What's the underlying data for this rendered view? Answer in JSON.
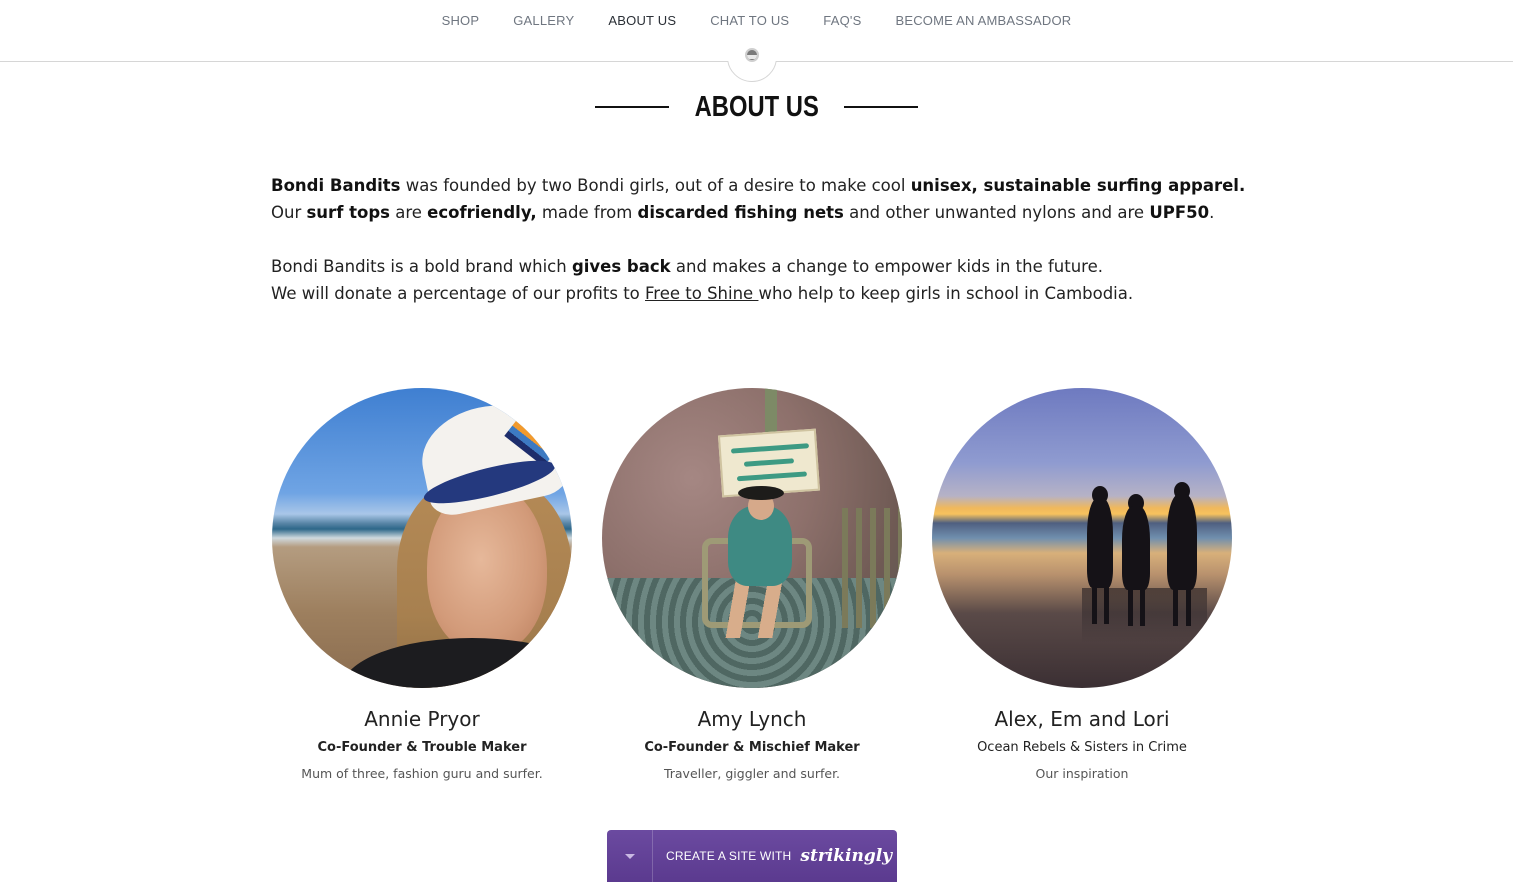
{
  "nav": {
    "items": [
      {
        "label": "SHOP"
      },
      {
        "label": "GALLERY"
      },
      {
        "label": "ABOUT US"
      },
      {
        "label": "CHAT TO US"
      },
      {
        "label": "FAQ'S"
      },
      {
        "label": "BECOME AN AMBASSADOR"
      }
    ],
    "active_index": 2
  },
  "section": {
    "title": "ABOUT US"
  },
  "intro": {
    "p1": {
      "brand": "Bondi Bandits",
      "t1": " was founded by two Bondi girls, out of a desire to make cool ",
      "b1": "unisex, sustainable surfing apparel.",
      "t2": "Our ",
      "b2": "surf tops",
      "t3": " are ",
      "b3": "ecofriendly,",
      "t4": " made from ",
      "b4": "discarded fishing nets",
      "t5": " and other unwanted nylons and are ",
      "b5": "UPF50",
      "t6": "."
    },
    "p2": {
      "t1": "Bondi Bandits is a bold brand which ",
      "b1": "gives back",
      "t2": " and makes a change to empower kids in the future.",
      "t3": "We will donate a percentage of our profits to ",
      "link": "Free to Shine ",
      "t4": "who help to keep girls in school in Cambodia."
    }
  },
  "team": [
    {
      "name": "Annie Pryor",
      "role": "Co-Founder & Trouble Maker",
      "desc": "Mum of three, fashion guru and surfer."
    },
    {
      "name": "Amy Lynch",
      "role": "Co-Founder & Mischief Maker",
      "desc": "Traveller, giggler and surfer."
    },
    {
      "name": "Alex, Em and Lori",
      "role": "Ocean Rebels & Sisters in Crime",
      "desc": "Our inspiration"
    }
  ],
  "badge": {
    "text": "CREATE A SITE WITH",
    "brand": "strikingly",
    "color": "#5b3a8f"
  }
}
